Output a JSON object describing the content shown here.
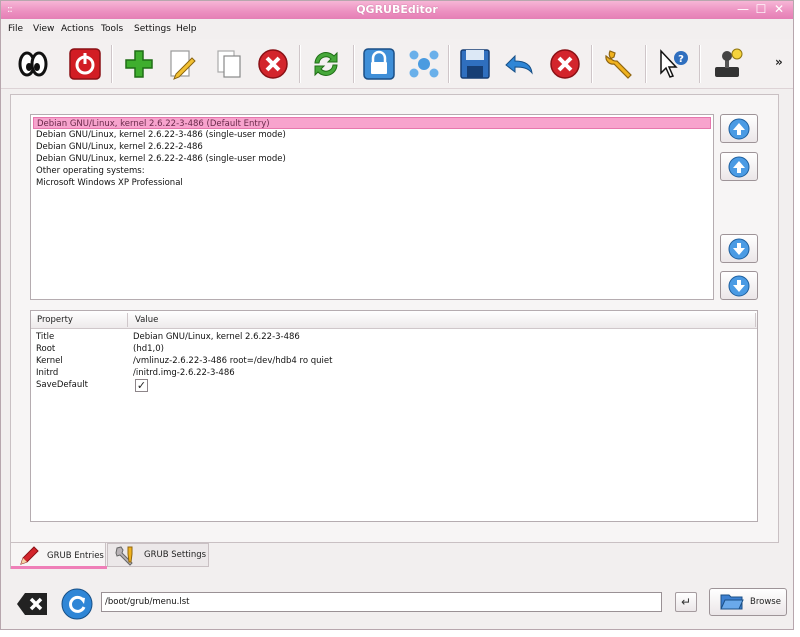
{
  "window": {
    "title": "QGRUBEditor",
    "grip": "::",
    "minimize": "—",
    "maximize": "☐",
    "close": "✕"
  },
  "menu": [
    "File",
    "View",
    "Actions",
    "Tools",
    "Settings",
    "Help"
  ],
  "toolbar": {
    "icons": [
      "eyes-icon",
      "power-icon",
      "add-icon",
      "edit-icon",
      "copy-icon",
      "delete-icon",
      "refresh-icon",
      "lock-icon",
      "network-icon",
      "save-icon",
      "undo-icon",
      "cancel-icon",
      "tools-icon",
      "whats-this-icon",
      "joystick-icon"
    ],
    "more": "»"
  },
  "entries": [
    "Debian GNU/Linux, kernel 2.6.22-3-486 (Default Entry)",
    "Debian GNU/Linux, kernel 2.6.22-3-486 (single-user mode)",
    "Debian GNU/Linux, kernel 2.6.22-2-486",
    "Debian GNU/Linux, kernel 2.6.22-2-486 (single-user mode)",
    "Other operating systems:",
    "Microsoft Windows XP Professional"
  ],
  "properties": {
    "headers": {
      "property": "Property",
      "value": "Value"
    },
    "rows": [
      {
        "key": "Title",
        "value": "Debian GNU/Linux, kernel 2.6.22-3-486"
      },
      {
        "key": "Root",
        "value": "(hd1,0)"
      },
      {
        "key": "Kernel",
        "value": "/vmlinuz-2.6.22-3-486 root=/dev/hdb4 ro quiet"
      },
      {
        "key": "Initrd",
        "value": "/initrd.img-2.6.22-3-486"
      },
      {
        "key": "SaveDefault",
        "value": "✓"
      }
    ]
  },
  "tabs": {
    "entries": "GRUB Entries",
    "settings": "GRUB Settings"
  },
  "bottom": {
    "path": "/boot/grub/menu.lst",
    "enter": "↵",
    "browse": "Browse"
  },
  "colors": {
    "accent": "#ef7fb8",
    "selection": "#f7a3cd",
    "titlebar": "#ec8fc0"
  }
}
